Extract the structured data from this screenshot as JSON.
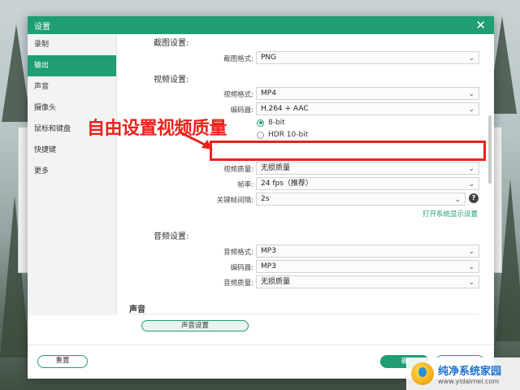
{
  "window": {
    "title": "设置"
  },
  "sidebar": {
    "items": [
      {
        "label": "录制",
        "active": false
      },
      {
        "label": "输出",
        "active": true
      },
      {
        "label": "声音",
        "active": false
      },
      {
        "label": "摄像头",
        "active": false
      },
      {
        "label": "鼠标和键盘",
        "active": false
      },
      {
        "label": "快捷键",
        "active": false
      },
      {
        "label": "更多",
        "active": false
      }
    ]
  },
  "screenshot_settings": {
    "title": "截图设置:",
    "format_label": "截图格式:",
    "format_value": "PNG"
  },
  "video_settings": {
    "title": "视频设置:",
    "format_label": "视频格式:",
    "format_value": "MP4",
    "encoder_label": "编码器:",
    "encoder_value": "H.264 + AAC",
    "bit_options": [
      {
        "label": "8-bit",
        "selected": true
      },
      {
        "label": "HDR 10-bit",
        "selected": false
      }
    ],
    "quality_label": "视频质量:",
    "quality_value": "无损质量",
    "framerate_label": "帧率:",
    "framerate_value": "24 fps（推荐）",
    "keyframe_label": "关键帧间隔:",
    "keyframe_value": "2s",
    "help_label": "?",
    "system_link": "打开系统显示设置"
  },
  "audio_settings": {
    "title": "音频设置:",
    "format_label": "音频格式:",
    "format_value": "MP3",
    "encoder_label": "编码器:",
    "encoder_value": "MP3",
    "quality_label": "音频质量:",
    "quality_value": "无损质量"
  },
  "sound_section": {
    "title": "声音",
    "button_label": "声音设置"
  },
  "footer": {
    "reset_label": "重置",
    "ok_label": "确",
    "cancel_label": ""
  },
  "annotation": {
    "text": "自由设置视频质量",
    "color": "#e8231b"
  },
  "watermark": {
    "title": "纯净系统家园",
    "url": "www.yidaimei.com"
  },
  "colors": {
    "accent": "#1e9e72"
  }
}
